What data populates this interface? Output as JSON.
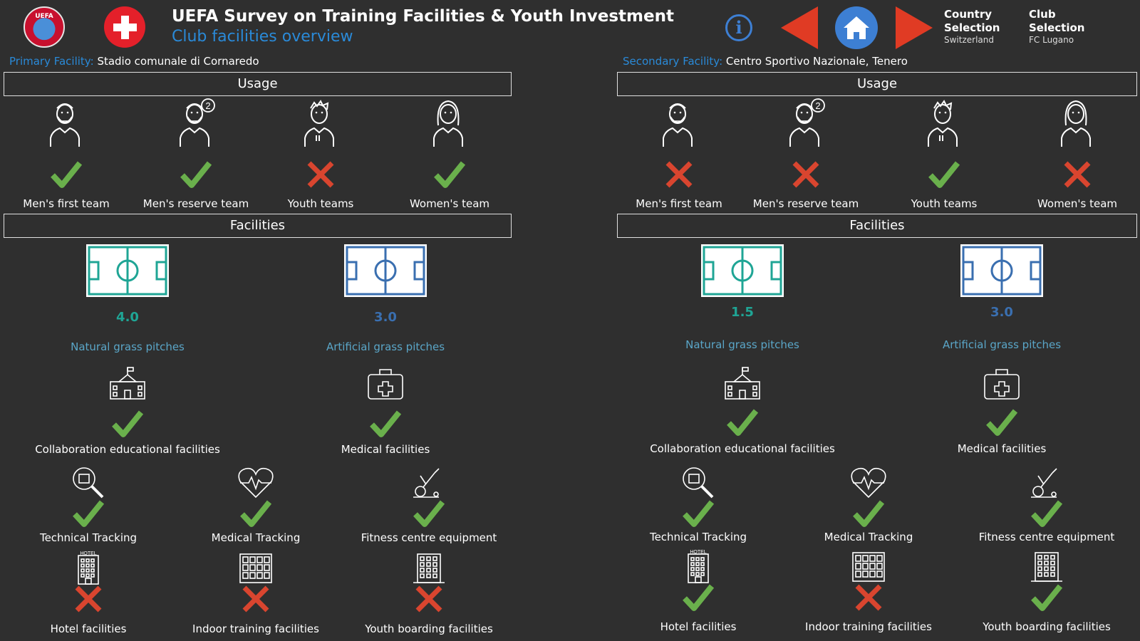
{
  "header": {
    "title": "UEFA Survey on Training Facilities & Youth Investment",
    "subtitle": "Club facilities overview",
    "uefa_logo_text": "UEFA",
    "country_selection_label": "Country Selection",
    "country_value": "Switzerland",
    "club_selection_label": "Club Selection",
    "club_value": "FC Lugano"
  },
  "colors": {
    "accent": "#2a8ad8",
    "check": "#6ab04c",
    "cross": "#d9452f",
    "natural": "#1fa595",
    "artificial": "#3a6fb0"
  },
  "panels": [
    {
      "facility_key": "Primary Facility:",
      "facility_name": "Stadio comunale di Cornaredo",
      "usage_title": "Usage",
      "facilities_title": "Facilities",
      "usage": [
        {
          "label": "Men's first team",
          "available": true
        },
        {
          "label": "Men's reserve team",
          "available": true
        },
        {
          "label": "Youth teams",
          "available": false
        },
        {
          "label": "Women's team",
          "available": true
        }
      ],
      "pitches": [
        {
          "value": "4.0",
          "label": "Natural grass pitches"
        },
        {
          "value": "3.0",
          "label": "Artificial grass pitches"
        }
      ],
      "facilities_row1": [
        {
          "label": "Collaboration educational facilities",
          "available": true,
          "icon": "school-icon"
        },
        {
          "label": "Medical facilities",
          "available": true,
          "icon": "medical-kit-icon"
        }
      ],
      "facilities_row2": [
        {
          "label": "Technical Tracking",
          "available": true,
          "icon": "magnifier-icon"
        },
        {
          "label": "Medical Tracking",
          "available": true,
          "icon": "heart-pulse-icon"
        },
        {
          "label": "Fitness centre equipment",
          "available": true,
          "icon": "exercise-bike-icon"
        }
      ],
      "facilities_row3": [
        {
          "label": "Hotel facilities",
          "available": false,
          "icon": "hotel-icon"
        },
        {
          "label": "Indoor training facilities",
          "available": false,
          "icon": "indoor-building-icon"
        },
        {
          "label": "Youth boarding facilities",
          "available": false,
          "icon": "boarding-building-icon"
        }
      ]
    },
    {
      "facility_key": "Secondary Facility:",
      "facility_name": "Centro Sportivo Nazionale, Tenero",
      "usage_title": "Usage",
      "facilities_title": "Facilities",
      "usage": [
        {
          "label": "Men's first team",
          "available": false
        },
        {
          "label": "Men's reserve team",
          "available": false
        },
        {
          "label": "Youth teams",
          "available": true
        },
        {
          "label": "Women's team",
          "available": false
        }
      ],
      "pitches": [
        {
          "value": "1.5",
          "label": "Natural grass pitches"
        },
        {
          "value": "3.0",
          "label": "Artificial grass pitches"
        }
      ],
      "facilities_row1": [
        {
          "label": "Collaboration educational facilities",
          "available": true,
          "icon": "school-icon"
        },
        {
          "label": "Medical facilities",
          "available": true,
          "icon": "medical-kit-icon"
        }
      ],
      "facilities_row2": [
        {
          "label": "Technical Tracking",
          "available": true,
          "icon": "magnifier-icon"
        },
        {
          "label": "Medical Tracking",
          "available": true,
          "icon": "heart-pulse-icon"
        },
        {
          "label": "Fitness centre equipment",
          "available": true,
          "icon": "exercise-bike-icon"
        }
      ],
      "facilities_row3": [
        {
          "label": "Hotel facilities",
          "available": true,
          "icon": "hotel-icon"
        },
        {
          "label": "Indoor training facilities",
          "available": false,
          "icon": "indoor-building-icon"
        },
        {
          "label": "Youth boarding facilities",
          "available": true,
          "icon": "boarding-building-icon"
        }
      ]
    }
  ]
}
